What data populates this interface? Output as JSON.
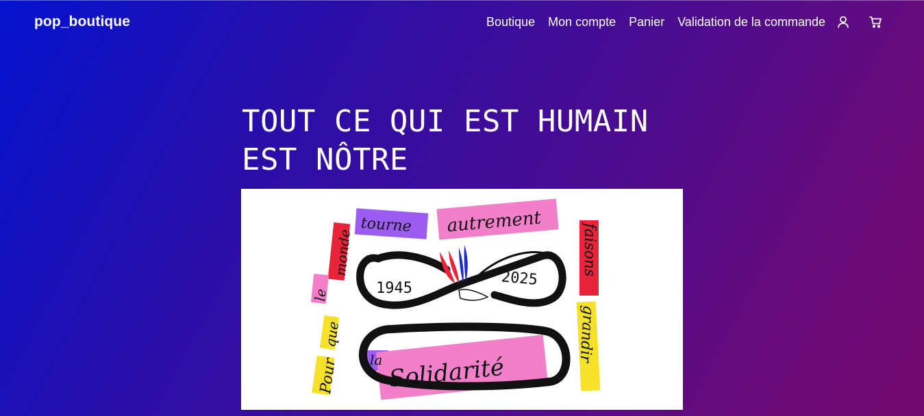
{
  "header": {
    "brand": "pop_boutique",
    "nav": [
      {
        "label": "Boutique"
      },
      {
        "label": "Mon compte"
      },
      {
        "label": "Panier"
      },
      {
        "label": "Validation de la commande"
      }
    ],
    "icons": [
      "user-icon",
      "cart-icon"
    ]
  },
  "hero": {
    "title_line1": "TOUT CE QUI EST HUMAIN",
    "title_line2": "EST NÔTRE"
  },
  "poster": {
    "year_left": "1945",
    "year_right": "2025",
    "words": {
      "tourne": "tourne",
      "autrement": "autrement",
      "le": "le",
      "monde": "monde",
      "faisons": "faisons",
      "grandir": "grandir",
      "pour": "Pour",
      "que": "que",
      "la": "la",
      "solidarite": "Solidarité"
    },
    "colors": {
      "pink": "#f27fc9",
      "purple": "#9b5cf0",
      "red": "#e8243a",
      "yellow": "#f6e12a",
      "ink": "#111111",
      "blue": "#1c2bc7"
    }
  }
}
